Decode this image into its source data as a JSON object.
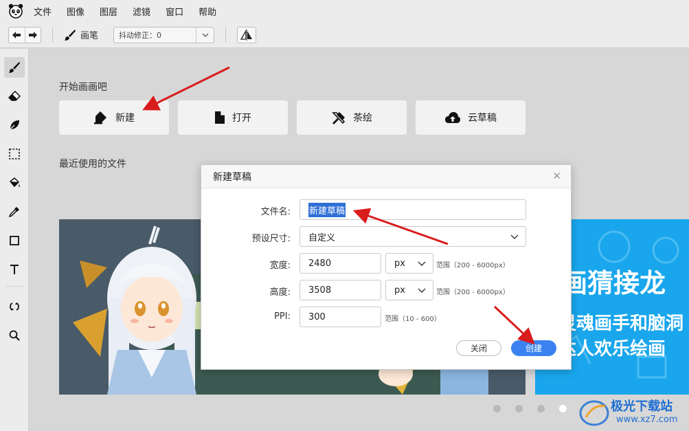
{
  "menubar": {
    "items": [
      "文件",
      "图像",
      "图层",
      "滤镜",
      "窗口",
      "帮助"
    ]
  },
  "toolbar": {
    "brush_label": "画笔",
    "shake_correction": "抖动修正：0"
  },
  "tools": [
    "brush-icon",
    "eraser-icon",
    "smudge-icon",
    "selection-icon",
    "fill-icon",
    "eyedropper-icon",
    "rectangle-icon",
    "text-icon",
    "rotate-icon",
    "zoom-icon"
  ],
  "start": {
    "title": "开始画画吧",
    "buttons": [
      "新建",
      "打开",
      "茶绘",
      "云草稿"
    ]
  },
  "recent": {
    "title": "最近使用的文件",
    "banner_lines": [
      "画猜接龙",
      "灵魂画手和脑洞",
      "达人欢乐绘画"
    ]
  },
  "dialog": {
    "title": "新建草稿",
    "filename_label": "文件名:",
    "filename_value": "新建草稿",
    "preset_label": "预设尺寸:",
    "preset_value": "自定义",
    "width_label": "宽度:",
    "width_value": "2480",
    "width_unit": "px",
    "width_hint": "范围（200 - 6000px）",
    "height_label": "高度:",
    "height_value": "3508",
    "height_unit": "px",
    "height_hint": "范围（200 - 6000px）",
    "ppi_label": "PPI:",
    "ppi_value": "300",
    "ppi_hint": "范围（10 - 600）",
    "close_label": "关闭",
    "create_label": "创建"
  },
  "carousel": {
    "count": 4,
    "active_index": 3
  },
  "watermark": {
    "text": "极光下载站",
    "url": "www.xz7.com"
  },
  "colors": {
    "accent": "#3b82f0",
    "annotation_arrow": "#d91c1c",
    "banner_blue": "#19a6ec"
  }
}
